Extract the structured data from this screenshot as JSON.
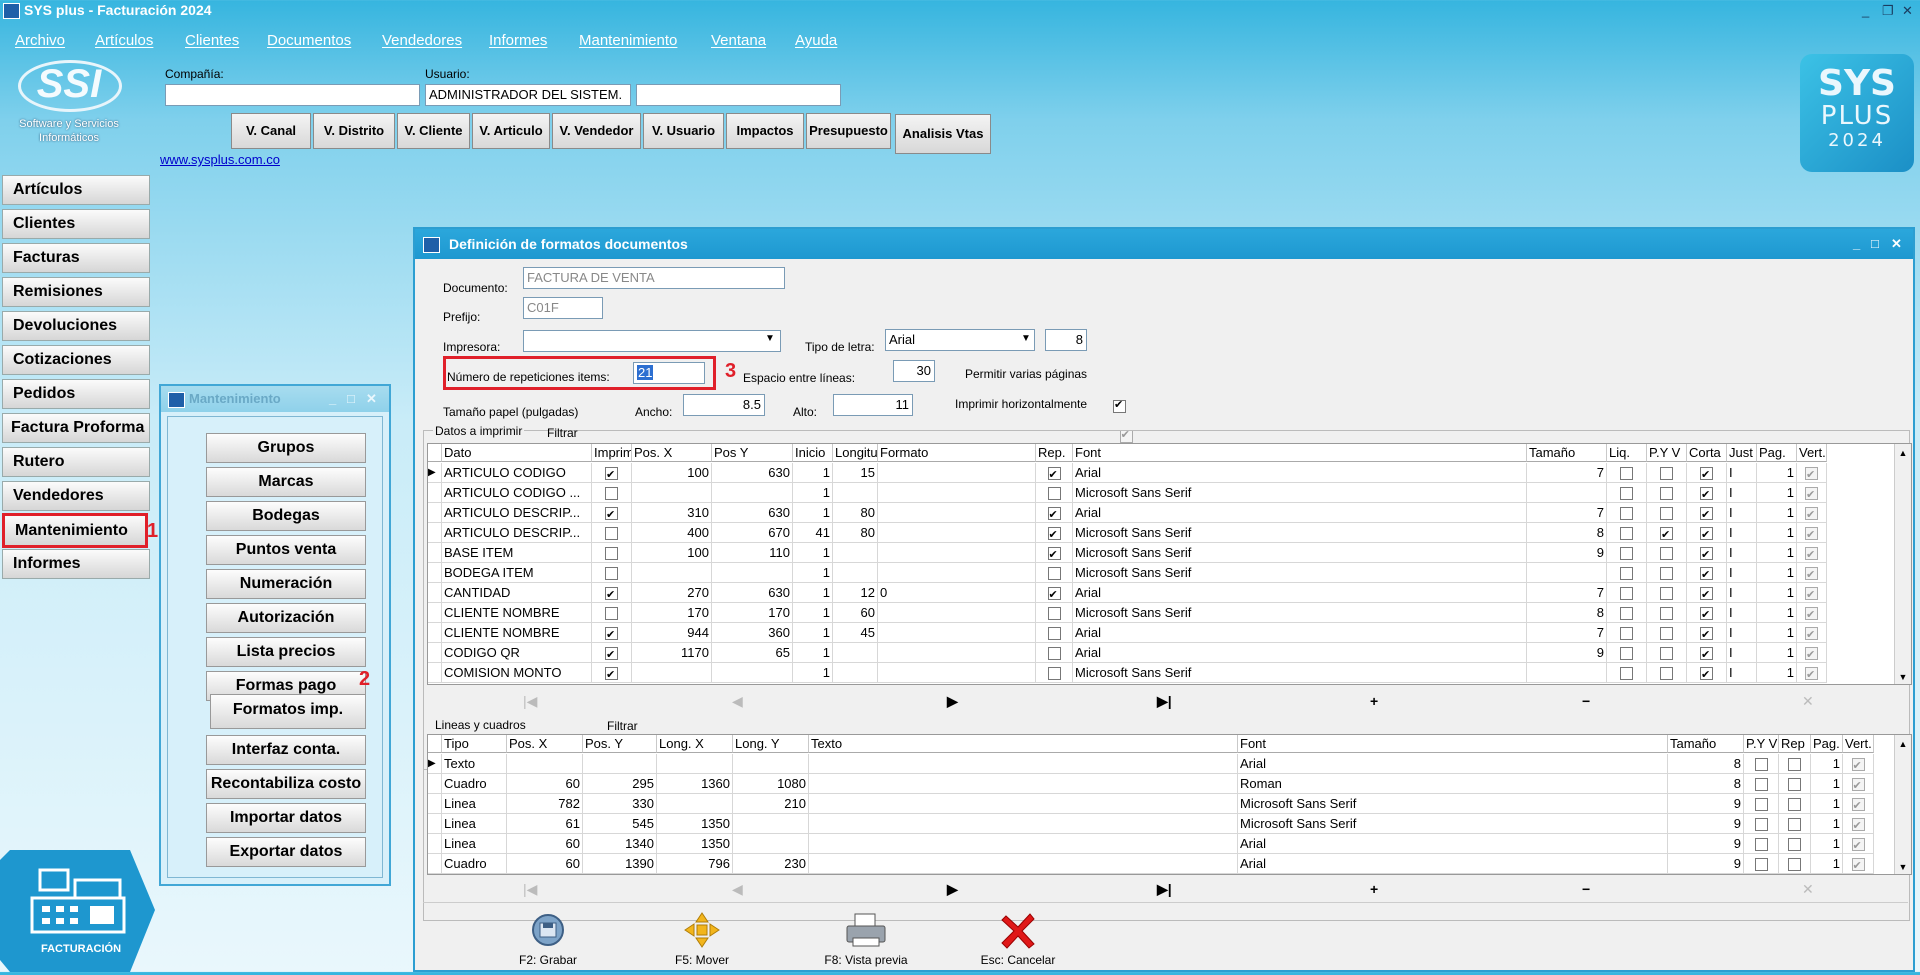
{
  "app": {
    "title": "SYS plus - Facturación 2024",
    "controls": [
      "_",
      "❐",
      "✕"
    ]
  },
  "menu": [
    "Archivo",
    "Artículos",
    "Clientes",
    "Documentos",
    "Vendedores",
    "Informes",
    "Mantenimiento",
    "Ventana",
    "Ayuda"
  ],
  "logo": {
    "text": "SSI",
    "subtitle1": "Software y Servicios",
    "subtitle2": "Informáticos"
  },
  "header": {
    "company_label": "Compañía:",
    "company_value": "",
    "user_label": "Usuario:",
    "user_value": "ADMINISTRADOR DEL SISTEM.",
    "user_extra": ""
  },
  "toolbar": [
    "V. Canal",
    "V. Distrito",
    "V. Cliente",
    "V. Articulo",
    "V. Vendedor",
    "V. Usuario",
    "Impactos",
    "Presupuesto",
    "Analisis Vtas"
  ],
  "website": "www.sysplus.com.co",
  "sys_logo": {
    "line1": "SYS",
    "line2": "PLUS",
    "line3": "2024"
  },
  "nav": [
    "Artículos",
    "Clientes",
    "Facturas",
    "Remisiones",
    "Devoluciones",
    "Cotizaciones",
    "Pedidos",
    "Factura Proforma",
    "Rutero",
    "Vendedores",
    "Mantenimiento",
    "Informes"
  ],
  "badge": {
    "label": "FACTURACIÓN"
  },
  "annotations": {
    "n1": "1",
    "n2": "2",
    "n3": "3"
  },
  "mant": {
    "title": "Mantenimiento",
    "buttons": [
      "Grupos",
      "Marcas",
      "Bodegas",
      "Puntos venta",
      "Numeración",
      "Autorización",
      "Lista precios",
      "Formas pago",
      "Formatos imp.",
      "Interfaz conta.",
      "Recontabiliza costo",
      "Importar datos",
      "Exportar datos"
    ]
  },
  "form": {
    "title": "Definición de formatos documentos",
    "documento_label": "Documento:",
    "documento_value": "FACTURA DE VENTA",
    "prefijo_label": "Prefijo:",
    "prefijo_value": "C01F",
    "impresora_label": "Impresora:",
    "impresora_value": "",
    "tipo_letra_label": "Tipo de letra:",
    "tipo_letra_value": "Arial",
    "tipo_letra_size": "8",
    "repeticiones_label": "Número de repeticiones items:",
    "repeticiones_value": "21",
    "espacio_label": "Espacio entre líneas:",
    "espacio_value": "30",
    "varias_paginas_label": "Permitir varias páginas",
    "tamano_label": "Tamaño papel (pulgadas)",
    "ancho_label": "Ancho:",
    "ancho_value": "8.5",
    "alto_label": "Alto:",
    "alto_value": "11",
    "horizontal_label": "Imprimir horizontalmente"
  },
  "datos": {
    "group_label": "Datos a imprimir",
    "filter_label": "Filtrar",
    "headers": [
      "Dato",
      "Imprim",
      "Pos. X",
      "Pos Y",
      "Inicio",
      "Longitud",
      "Formato",
      "Rep.",
      "Font",
      "Tamaño",
      "Liq.",
      "P.Y V",
      "Corta",
      "Just",
      "Pag.",
      "Vert."
    ],
    "rows": [
      {
        "dato": "ARTICULO CODIGO",
        "imp": true,
        "x": "100",
        "y": "630",
        "ini": "1",
        "lon": "15",
        "fmt": "",
        "rep": true,
        "font": "Arial",
        "tam": "7",
        "liq": false,
        "pyv": false,
        "corta": true,
        "just": "I",
        "pag": "1",
        "vert": true
      },
      {
        "dato": "ARTICULO CODIGO ...",
        "imp": false,
        "x": "",
        "y": "",
        "ini": "1",
        "lon": "",
        "fmt": "",
        "rep": false,
        "font": "Microsoft Sans Serif",
        "tam": "",
        "liq": false,
        "pyv": false,
        "corta": true,
        "just": "I",
        "pag": "1",
        "vert": true
      },
      {
        "dato": "ARTICULO DESCRIP...",
        "imp": true,
        "x": "310",
        "y": "630",
        "ini": "1",
        "lon": "80",
        "fmt": "",
        "rep": true,
        "font": "Arial",
        "tam": "7",
        "liq": false,
        "pyv": false,
        "corta": true,
        "just": "I",
        "pag": "1",
        "vert": true
      },
      {
        "dato": "ARTICULO DESCRIP...",
        "imp": false,
        "x": "400",
        "y": "670",
        "ini": "41",
        "lon": "80",
        "fmt": "",
        "rep": true,
        "font": "Microsoft Sans Serif",
        "tam": "8",
        "liq": false,
        "pyv": true,
        "corta": true,
        "just": "I",
        "pag": "1",
        "vert": true
      },
      {
        "dato": "BASE ITEM",
        "imp": false,
        "x": "100",
        "y": "110",
        "ini": "1",
        "lon": "",
        "fmt": "",
        "rep": true,
        "font": "Microsoft Sans Serif",
        "tam": "9",
        "liq": false,
        "pyv": false,
        "corta": true,
        "just": "I",
        "pag": "1",
        "vert": true
      },
      {
        "dato": "BODEGA ITEM",
        "imp": false,
        "x": "",
        "y": "",
        "ini": "1",
        "lon": "",
        "fmt": "",
        "rep": false,
        "font": "Microsoft Sans Serif",
        "tam": "",
        "liq": false,
        "pyv": false,
        "corta": true,
        "just": "I",
        "pag": "1",
        "vert": true
      },
      {
        "dato": "CANTIDAD",
        "imp": true,
        "x": "270",
        "y": "630",
        "ini": "1",
        "lon": "12",
        "fmt": "0",
        "rep": true,
        "font": "Arial",
        "tam": "7",
        "liq": false,
        "pyv": false,
        "corta": true,
        "just": "I",
        "pag": "1",
        "vert": true
      },
      {
        "dato": "CLIENTE NOMBRE",
        "imp": false,
        "x": "170",
        "y": "170",
        "ini": "1",
        "lon": "60",
        "fmt": "",
        "rep": false,
        "font": "Microsoft Sans Serif",
        "tam": "8",
        "liq": false,
        "pyv": false,
        "corta": true,
        "just": "I",
        "pag": "1",
        "vert": true
      },
      {
        "dato": "CLIENTE NOMBRE",
        "imp": true,
        "x": "944",
        "y": "360",
        "ini": "1",
        "lon": "45",
        "fmt": "",
        "rep": false,
        "font": "Arial",
        "tam": "7",
        "liq": false,
        "pyv": false,
        "corta": true,
        "just": "I",
        "pag": "1",
        "vert": true
      },
      {
        "dato": "CODIGO QR",
        "imp": true,
        "x": "1170",
        "y": "65",
        "ini": "1",
        "lon": "",
        "fmt": "",
        "rep": false,
        "font": "Arial",
        "tam": "9",
        "liq": false,
        "pyv": false,
        "corta": true,
        "just": "I",
        "pag": "1",
        "vert": true
      },
      {
        "dato": "COMISION MONTO",
        "imp": true,
        "x": "",
        "y": "",
        "ini": "1",
        "lon": "",
        "fmt": "",
        "rep": false,
        "font": "Microsoft Sans Serif",
        "tam": "",
        "liq": false,
        "pyv": false,
        "corta": true,
        "just": "I",
        "pag": "1",
        "vert": true
      }
    ]
  },
  "lineas": {
    "group_label": "Lineas y cuadros",
    "filter_label": "Filtrar",
    "headers": [
      "Tipo",
      "Pos. X",
      "Pos. Y",
      "Long. X",
      "Long. Y",
      "Texto",
      "Font",
      "Tamaño",
      "P.Y V",
      "Rep",
      "Pag.",
      "Vert."
    ],
    "rows": [
      {
        "tipo": "Texto",
        "x": "",
        "y": "",
        "lx": "",
        "ly": "",
        "texto": "",
        "font": "Arial",
        "tam": "8",
        "pyv": false,
        "rep": false,
        "pag": "1",
        "vert": true
      },
      {
        "tipo": "Cuadro",
        "x": "60",
        "y": "295",
        "lx": "1360",
        "ly": "1080",
        "texto": "",
        "font": "Roman",
        "tam": "8",
        "pyv": false,
        "rep": false,
        "pag": "1",
        "vert": true
      },
      {
        "tipo": "Linea",
        "x": "782",
        "y": "330",
        "lx": "",
        "ly": "210",
        "texto": "",
        "font": "Microsoft Sans Serif",
        "tam": "9",
        "pyv": false,
        "rep": false,
        "pag": "1",
        "vert": true
      },
      {
        "tipo": "Linea",
        "x": "61",
        "y": "545",
        "lx": "1350",
        "ly": "",
        "texto": "",
        "font": "Microsoft Sans Serif",
        "tam": "9",
        "pyv": false,
        "rep": false,
        "pag": "1",
        "vert": true
      },
      {
        "tipo": "Linea",
        "x": "60",
        "y": "1340",
        "lx": "1350",
        "ly": "",
        "texto": "",
        "font": "Arial",
        "tam": "9",
        "pyv": false,
        "rep": false,
        "pag": "1",
        "vert": true
      },
      {
        "tipo": "Cuadro",
        "x": "60",
        "y": "1390",
        "lx": "796",
        "ly": "230",
        "texto": "",
        "font": "Arial",
        "tam": "9",
        "pyv": false,
        "rep": false,
        "pag": "1",
        "vert": true
      }
    ]
  },
  "navigator": [
    "|◀",
    "◀",
    "▶",
    "▶|",
    "+",
    "−",
    "✕"
  ],
  "actions": [
    {
      "label": "F2: Grabar",
      "icon": "save-icon"
    },
    {
      "label": "F5: Mover",
      "icon": "move-icon"
    },
    {
      "label": "F8: Vista previa",
      "icon": "print-preview-icon"
    },
    {
      "label": "Esc: Cancelar",
      "icon": "cancel-icon"
    }
  ]
}
